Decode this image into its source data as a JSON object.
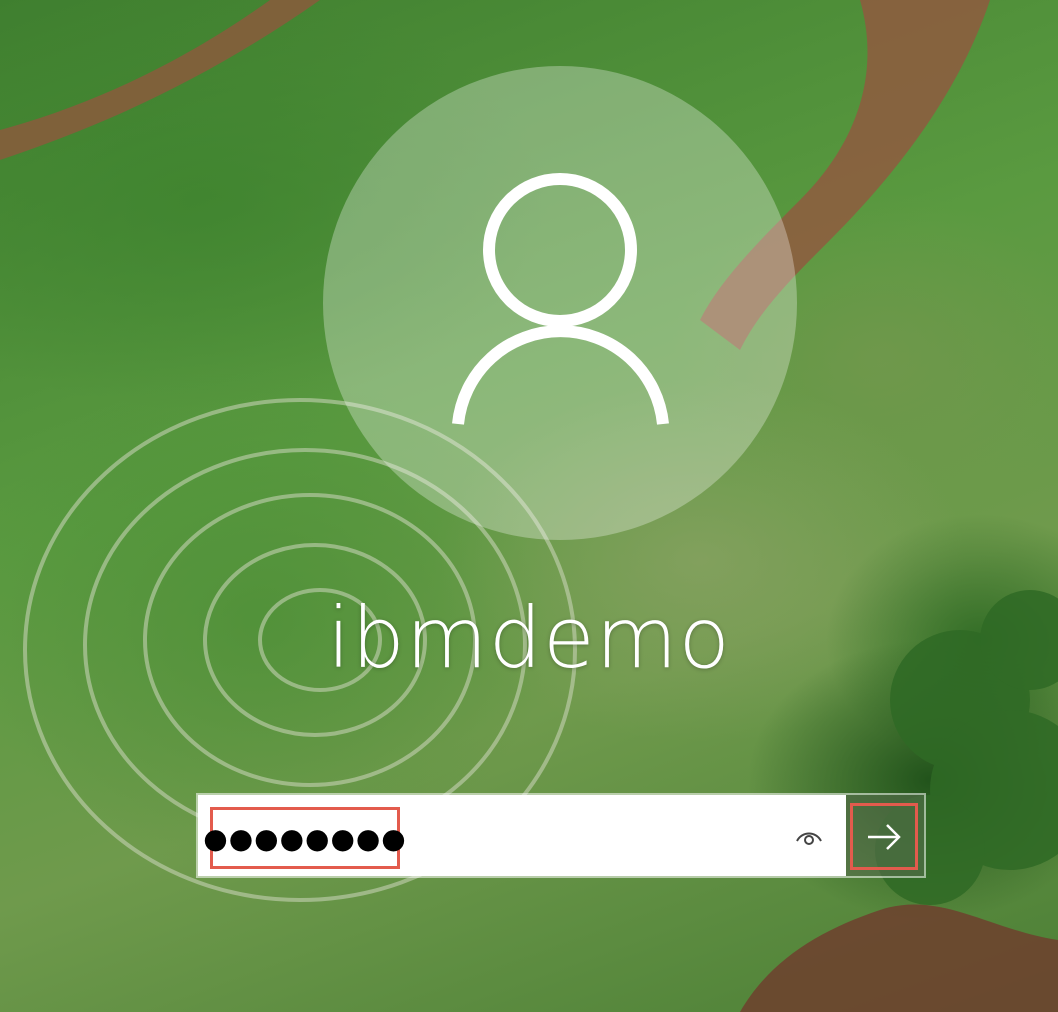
{
  "user": {
    "username": "ibmdemo",
    "avatar_icon": "user-icon"
  },
  "password": {
    "masked_value": "●●●●●●●●",
    "reveal_icon": "eye-icon"
  },
  "submit": {
    "icon": "arrow-right-icon"
  },
  "colors": {
    "highlight": "#e35b4d",
    "text": "#ffffff"
  }
}
